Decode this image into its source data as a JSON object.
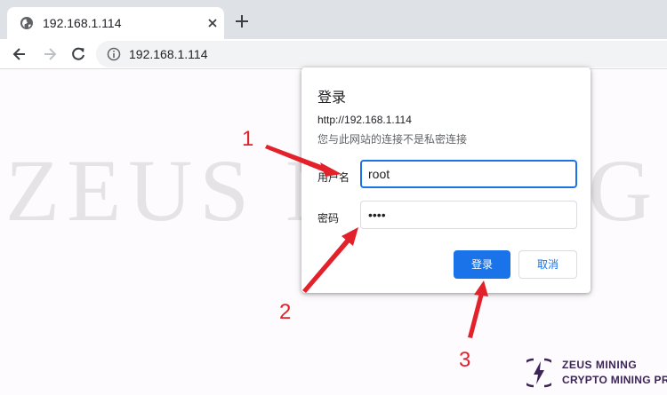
{
  "browser": {
    "tab_title": "192.168.1.114",
    "address": "192.168.1.114"
  },
  "watermark": {
    "text": "ZEUS MINING"
  },
  "dialog": {
    "title": "登录",
    "url": "http://192.168.1.114",
    "warning": "您与此网站的连接不是私密连接",
    "username_label": "用户名",
    "username_value": "root",
    "password_label": "密码",
    "password_value": "root",
    "login_label": "登录",
    "cancel_label": "取消"
  },
  "annotations": {
    "step1": "1",
    "step2": "2",
    "step3": "3",
    "color": "#e3212b"
  },
  "logo": {
    "line1": "ZEUS MINING",
    "line2": "CRYPTO MINING PRO",
    "color": "#3d2458"
  },
  "colors": {
    "primary": "#1a73e8",
    "tabbar": "#dee1e6"
  },
  "icons": [
    "globe-icon",
    "close-icon",
    "plus-icon",
    "back-arrow-icon",
    "forward-arrow-icon",
    "reload-icon",
    "info-icon",
    "lightning-logo-icon"
  ]
}
